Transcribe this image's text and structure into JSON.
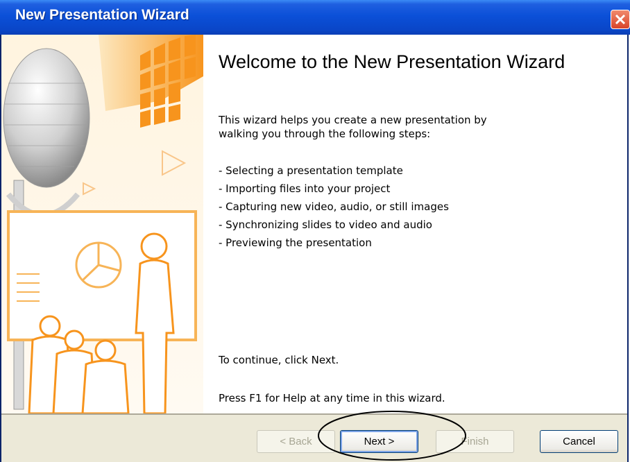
{
  "window": {
    "title": "New Presentation Wizard",
    "close_icon": "close-icon"
  },
  "content": {
    "heading": "Welcome to the New Presentation Wizard",
    "intro_line1": "This wizard helps you create a new presentation by",
    "intro_line2": "walking you through the following steps:",
    "steps": [
      "- Selecting a presentation template",
      "- Importing files into your project",
      "- Capturing new video, audio, or still images",
      "- Synchronizing slides to video and audio",
      "- Previewing the presentation"
    ],
    "continue_text": "To continue, click Next.",
    "help_text": "Press F1 for Help at any time in this wizard."
  },
  "buttons": {
    "back": "< Back",
    "next": "Next >",
    "finish": "Finish",
    "cancel": "Cancel"
  },
  "colors": {
    "titlebar": "#0b50d8",
    "accent_orange": "#f7941d",
    "footer": "#ece9d8"
  }
}
